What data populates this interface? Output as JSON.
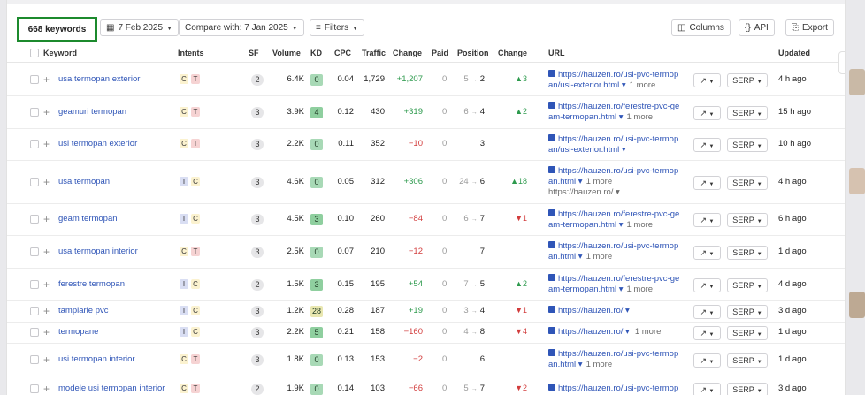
{
  "toolbar": {
    "keywords_count": "668 keywords",
    "date": "7 Feb 2025",
    "compare": "Compare with: 7 Jan 2025",
    "filters": "Filters",
    "columns": "Columns",
    "api": "API",
    "export": "Export"
  },
  "columns": {
    "keyword": "Keyword",
    "intents": "Intents",
    "sf": "SF",
    "volume": "Volume",
    "kd": "KD",
    "cpc": "CPC",
    "traffic": "Traffic",
    "change": "Change",
    "paid": "Paid",
    "position": "Position",
    "pos_change": "Change",
    "url": "URL",
    "updated": "Updated"
  },
  "serp_label": "SERP",
  "rows": [
    {
      "keyword": "usa termopan exterior",
      "intents": [
        "C",
        "T"
      ],
      "sf": "2",
      "volume": "6.4K",
      "kd": "0",
      "cpc": "0.04",
      "traffic": "1,729",
      "change": "+1,207",
      "paid": "0",
      "pos_from": "5",
      "pos_to": "2",
      "pos_change": "▲3",
      "url1": "https://hauzen.ro/usi-pvc-termop",
      "url2": "an/usi-exterior.html ▾",
      "more": "1 more",
      "updated": "4 h ago"
    },
    {
      "keyword": "geamuri termopan",
      "intents": [
        "C",
        "T"
      ],
      "sf": "3",
      "volume": "3.9K",
      "kd": "4",
      "cpc": "0.12",
      "traffic": "430",
      "change": "+319",
      "paid": "0",
      "pos_from": "6",
      "pos_to": "4",
      "pos_change": "▲2",
      "url1": "https://hauzen.ro/ferestre-pvc-ge",
      "url2": "am-termopan.html ▾",
      "more": "1 more",
      "updated": "15 h ago"
    },
    {
      "keyword": "usi termopan exterior",
      "intents": [
        "C",
        "T"
      ],
      "sf": "3",
      "volume": "2.2K",
      "kd": "0",
      "cpc": "0.11",
      "traffic": "352",
      "change": "−10",
      "paid": "0",
      "pos_from": "",
      "pos_to": "3",
      "pos_change": "",
      "url1": "https://hauzen.ro/usi-pvc-termop",
      "url2": "an/usi-exterior.html ▾",
      "more": "",
      "updated": "10 h ago"
    },
    {
      "keyword": "usa termopan",
      "intents": [
        "I",
        "C"
      ],
      "sf": "3",
      "volume": "4.6K",
      "kd": "0",
      "cpc": "0.05",
      "traffic": "312",
      "change": "+306",
      "paid": "0",
      "pos_from": "24",
      "pos_to": "6",
      "pos_change": "▲18",
      "url1": "https://hauzen.ro/usi-pvc-termop",
      "url2": "an.html ▾",
      "more": "1 more",
      "url3": "https://hauzen.ro/ ▾",
      "updated": "4 h ago"
    },
    {
      "keyword": "geam termopan",
      "intents": [
        "I",
        "C"
      ],
      "sf": "3",
      "volume": "4.5K",
      "kd": "3",
      "cpc": "0.10",
      "traffic": "260",
      "change": "−84",
      "paid": "0",
      "pos_from": "6",
      "pos_to": "7",
      "pos_change": "▼1",
      "url1": "https://hauzen.ro/ferestre-pvc-ge",
      "url2": "am-termopan.html ▾",
      "more": "1 more",
      "updated": "6 h ago"
    },
    {
      "keyword": "usa termopan interior",
      "intents": [
        "C",
        "T"
      ],
      "sf": "3",
      "volume": "2.5K",
      "kd": "0",
      "cpc": "0.07",
      "traffic": "210",
      "change": "−12",
      "paid": "0",
      "pos_from": "",
      "pos_to": "7",
      "pos_change": "",
      "url1": "https://hauzen.ro/usi-pvc-termop",
      "url2": "an.html ▾",
      "more": "1 more",
      "updated": "1 d ago"
    },
    {
      "keyword": "ferestre termopan",
      "intents": [
        "I",
        "C"
      ],
      "sf": "2",
      "volume": "1.5K",
      "kd": "3",
      "cpc": "0.15",
      "traffic": "195",
      "change": "+54",
      "paid": "0",
      "pos_from": "7",
      "pos_to": "5",
      "pos_change": "▲2",
      "url1": "https://hauzen.ro/ferestre-pvc-ge",
      "url2": "am-termopan.html ▾",
      "more": "1 more",
      "updated": "4 d ago"
    },
    {
      "keyword": "tamplarie pvc",
      "intents": [
        "I",
        "C"
      ],
      "sf": "3",
      "volume": "1.2K",
      "kd": "28",
      "cpc": "0.28",
      "traffic": "187",
      "change": "+19",
      "paid": "0",
      "pos_from": "3",
      "pos_to": "4",
      "pos_change": "▼1",
      "url1": "https://hauzen.ro/ ▾",
      "url2": "",
      "more": "",
      "updated": "3 d ago"
    },
    {
      "keyword": "termopane",
      "intents": [
        "I",
        "C"
      ],
      "sf": "3",
      "volume": "2.2K",
      "kd": "5",
      "cpc": "0.21",
      "traffic": "158",
      "change": "−160",
      "paid": "0",
      "pos_from": "4",
      "pos_to": "8",
      "pos_change": "▼4",
      "url1": "https://hauzen.ro/ ▾",
      "url2": "",
      "more": "1 more",
      "updated": "1 d ago"
    },
    {
      "keyword": "usi termopan interior",
      "intents": [
        "C",
        "T"
      ],
      "sf": "3",
      "volume": "1.8K",
      "kd": "0",
      "cpc": "0.13",
      "traffic": "153",
      "change": "−2",
      "paid": "0",
      "pos_from": "",
      "pos_to": "6",
      "pos_change": "",
      "url1": "https://hauzen.ro/usi-pvc-termop",
      "url2": "an.html ▾",
      "more": "1 more",
      "updated": "1 d ago"
    },
    {
      "keyword": "modele usi termopan interior",
      "intents": [
        "C",
        "T"
      ],
      "sf": "2",
      "volume": "1.9K",
      "kd": "0",
      "cpc": "0.14",
      "traffic": "103",
      "change": "−66",
      "paid": "0",
      "pos_from": "5",
      "pos_to": "7",
      "pos_change": "▼2",
      "url1": "https://hauzen.ro/usi-pvc-termop",
      "url2": "",
      "more": "",
      "updated": "3 d ago"
    }
  ],
  "colors": {
    "accent_border": "#1c8a2d",
    "link": "#2f55b7",
    "positive": "#2d9a4d",
    "negative": "#d23c3c",
    "kd_zero": "#a8d9b6",
    "kd_low": "#8fcf9f",
    "kd_28": "#e9e7b0"
  }
}
